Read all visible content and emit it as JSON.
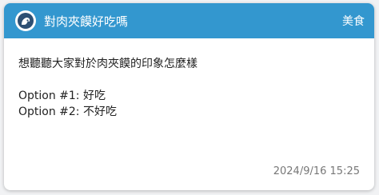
{
  "post": {
    "title": "對肉夾饃好吃嗎",
    "board": "美食",
    "avatar_icon": "person-avatar-icon",
    "header_color": "#3397cf",
    "body_line_1": "想聽聽大家對於肉夾饃的印象怎麼樣",
    "options": [
      "Option #1: 好吃",
      "Option #2: 不好吃"
    ],
    "timestamp": "2024/9/16 15:25"
  }
}
